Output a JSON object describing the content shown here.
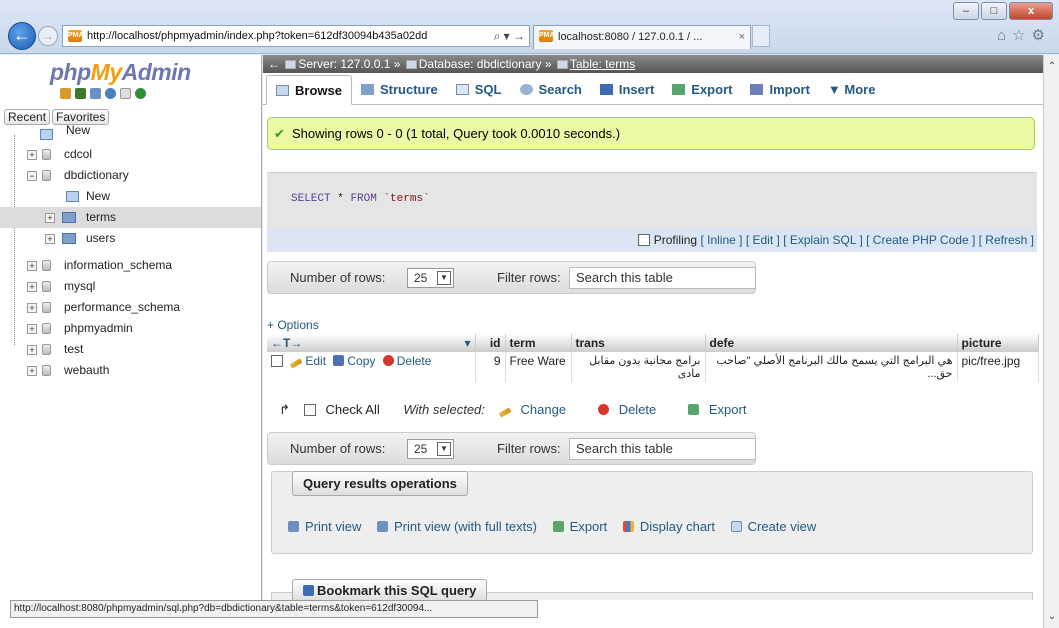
{
  "browser": {
    "url": "http://localhost/phpmyadmin/index.php?token=612df30094b435a02dd",
    "addr_tools": "⌕ ▾ →",
    "tab_title": "localhost:8080 / 127.0.0.1 / ...",
    "tab_close": "×",
    "window_buttons": {
      "minimize": "–",
      "maximize": "□",
      "close": "x"
    },
    "status_url": "http://localhost:8080/phpmyadmin/sql.php?db=dbdictionary&table=terms&token=612df30094..."
  },
  "nav": {
    "logo_php": "php",
    "logo_my": "My",
    "logo_admin": "Admin",
    "recent": "Recent",
    "favorites": "Favorites",
    "tree": {
      "new": "New",
      "cdcol": "cdcol",
      "dbdictionary": "dbdictionary",
      "db_new": "New",
      "terms": "terms",
      "users": "users",
      "information_schema": "information_schema",
      "mysql": "mysql",
      "performance_schema": "performance_schema",
      "phpmyadmin": "phpmyadmin",
      "test": "test",
      "webauth": "webauth"
    }
  },
  "breadcrumb": {
    "server": "Server: 127.0.0.1",
    "database": "Database: dbdictionary",
    "table": "Table: terms"
  },
  "menu": [
    "Browse",
    "Structure",
    "SQL",
    "Search",
    "Insert",
    "Export",
    "Import",
    "More"
  ],
  "success": "Showing rows 0 - 0 (1 total, Query took 0.0010 seconds.)",
  "sql": {
    "kw1": "SELECT",
    "star": "*",
    "kw2": "FROM",
    "table": "`terms`"
  },
  "sqlbar": {
    "profiling": "Profiling",
    "inline": "[ Inline ]",
    "edit": "[ Edit ]",
    "explain": "[ Explain SQL ]",
    "php": "[ Create PHP Code ]",
    "refresh": "[ Refresh ]"
  },
  "rows_nav": {
    "number_of_rows": "Number of rows:",
    "rows_value": "25",
    "filter_label": "Filter rows:",
    "filter_placeholder": "Search this table"
  },
  "options": "+ Options",
  "table": {
    "arrows": "←T→",
    "sort_arrow": "▾",
    "columns": [
      "id",
      "term",
      "trans",
      "defe",
      "picture"
    ],
    "row": {
      "edit": "Edit",
      "copy": "Copy",
      "delete": "Delete",
      "id": "9",
      "term": "Free Ware",
      "trans": "برامج مجانية بدون مقابل مادى",
      "defe": "هي البرامج التي يسمح مالك البرنامج الأصلي \"صاحب حق...",
      "picture": "pic/free.jpg"
    }
  },
  "bulk": {
    "check_all": "Check All",
    "with_selected": "With selected:",
    "change": "Change",
    "delete": "Delete",
    "export": "Export"
  },
  "qro": {
    "title": "Query results operations",
    "print": "Print view",
    "print_full": "Print view (with full texts)",
    "export": "Export",
    "chart": "Display chart",
    "view": "Create view"
  },
  "bookmark": "Bookmark this SQL query"
}
